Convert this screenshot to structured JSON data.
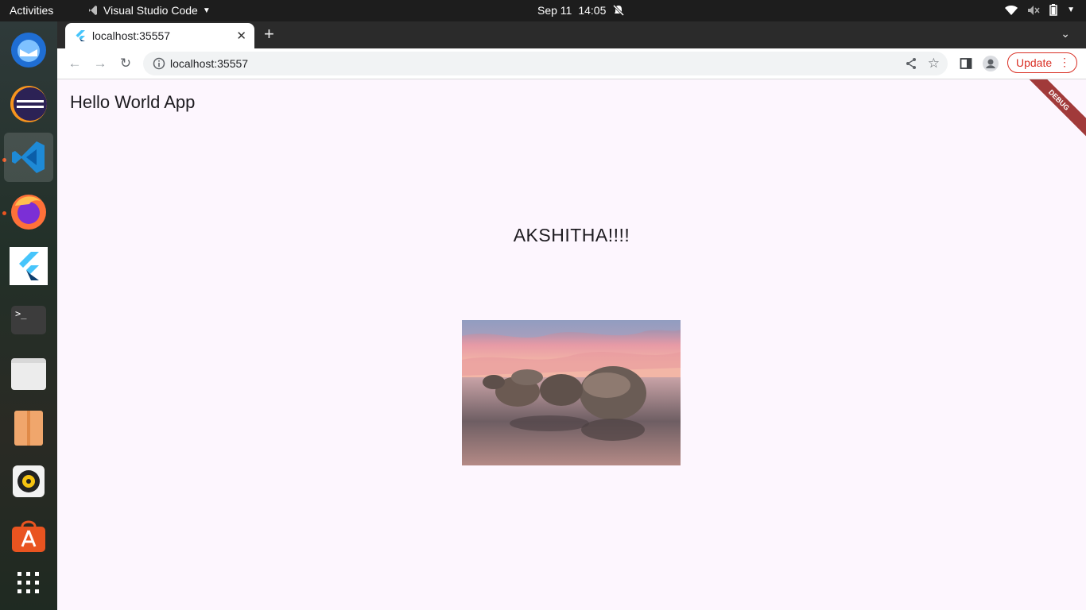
{
  "system_bar": {
    "activities": "Activities",
    "app_name": "Visual Studio Code",
    "date": "Sep 11",
    "time": "14:05"
  },
  "dock": {
    "items": [
      {
        "name": "thunderbird-icon"
      },
      {
        "name": "eclipse-icon"
      },
      {
        "name": "vscode-icon",
        "active": true
      },
      {
        "name": "firefox-icon"
      },
      {
        "name": "flutter-icon"
      },
      {
        "name": "terminal-icon"
      },
      {
        "name": "files-icon"
      },
      {
        "name": "archive-manager-icon"
      },
      {
        "name": "rhythmbox-icon"
      },
      {
        "name": "app-center-icon"
      },
      {
        "name": "show-apps-icon"
      }
    ]
  },
  "browser": {
    "tab_title": "localhost:35557",
    "url": "localhost:35557",
    "update_label": "Update"
  },
  "page": {
    "app_title": "Hello World App",
    "heading": "AKSHITHA!!!!",
    "debug_banner": "DEBUG"
  },
  "colors": {
    "page_background": "#fdf6fe",
    "debug_banner": "#a13a3a",
    "update_accent": "#d93025"
  }
}
